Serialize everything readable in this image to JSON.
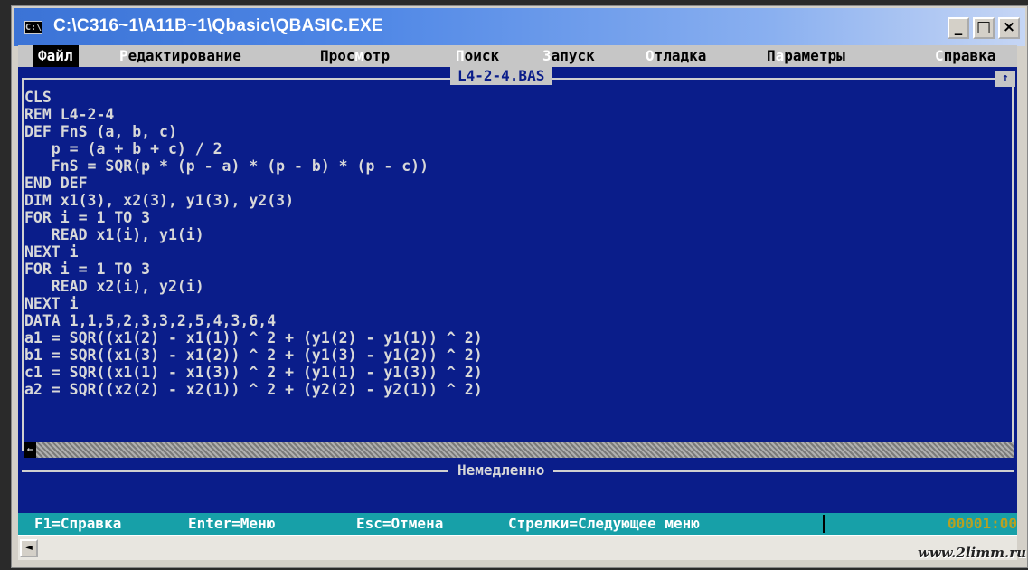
{
  "window": {
    "title": "C:\\C316~1\\A11B~1\\Qbasic\\QBASIC.EXE",
    "icon": "C:\\",
    "minimize": "_",
    "maximize": "□",
    "close": "×"
  },
  "menu": {
    "file": "Файл",
    "edit_hot": "Р",
    "edit_rest": "едактирование",
    "view_a": "Прос",
    "view_hot": "м",
    "view_b": "отр",
    "search_hot": "П",
    "search_rest": "оиск",
    "run_hot": "З",
    "run_rest": "апуск",
    "debug_hot": "О",
    "debug_rest": "тладка",
    "options_a": "П",
    "options_hot": "а",
    "options_b": "раметры",
    "help_hot": "С",
    "help_rest": "правка"
  },
  "editor": {
    "filename": "L4-2-4.BAS",
    "max_icon": "↑",
    "scroll_left": "←",
    "lines": [
      "CLS",
      "REM L4-2-4",
      "DEF FnS (a, b, c)",
      "   p = (a + b + c) / 2",
      "   FnS = SQR(p * (p - a) * (p - b) * (p - c))",
      "END DEF",
      "DIM x1(3), x2(3), y1(3), y2(3)",
      "FOR i = 1 TO 3",
      "   READ x1(i), y1(i)",
      "NEXT i",
      "FOR i = 1 TO 3",
      "   READ x2(i), y2(i)",
      "NEXT i",
      "DATA 1,1,5,2,3,3,2,5,4,3,6,4",
      "a1 = SQR((x1(2) - x1(1)) ^ 2 + (y1(2) - y1(1)) ^ 2)",
      "b1 = SQR((x1(3) - x1(2)) ^ 2 + (y1(3) - y1(2)) ^ 2)",
      "c1 = SQR((x1(1) - x1(3)) ^ 2 + (y1(1) - y1(3)) ^ 2)",
      "a2 = SQR((x2(2) - x2(1)) ^ 2 + (y2(2) - y2(1)) ^ 2)"
    ]
  },
  "immediate": {
    "title": "Немедленно"
  },
  "status": {
    "help": "F1=Справка",
    "menu": "Enter=Меню",
    "cancel": "Esc=Отмена",
    "arrows": "Стрелки=Следующее меню",
    "position": "00001:00"
  },
  "bottom": {
    "scroll_left": "◄",
    "watermark": "www.2limm.ru"
  }
}
